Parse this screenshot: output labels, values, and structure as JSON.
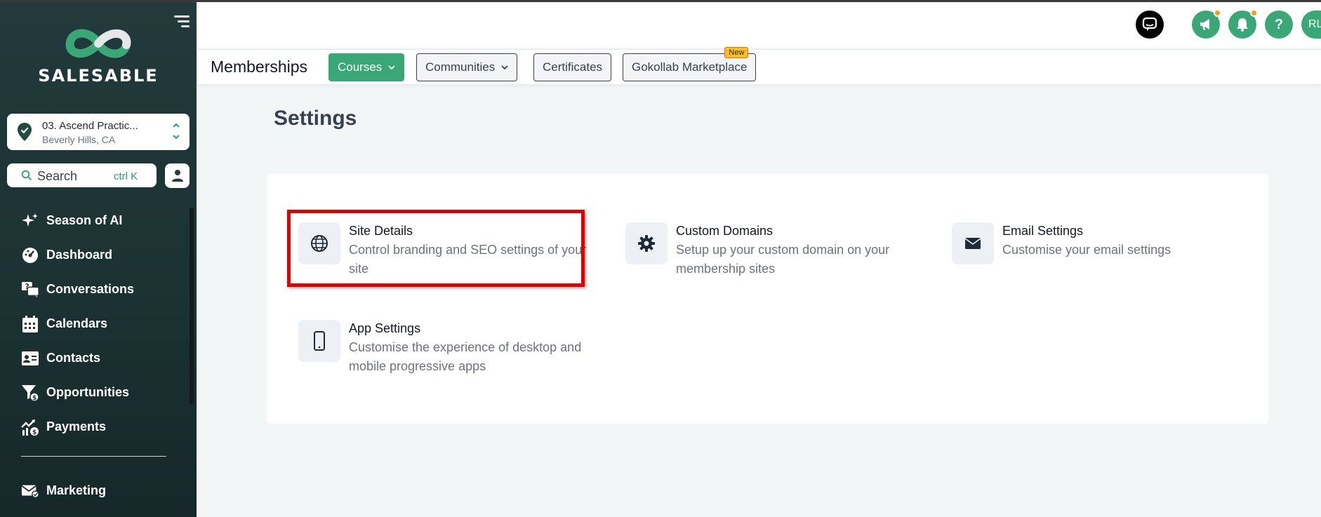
{
  "sidebar": {
    "brand": "SALESABLE",
    "location": {
      "name": "03. Ascend Practic...",
      "sub": "Beverly Hills, CA"
    },
    "search": {
      "label": "Search",
      "shortcut": "ctrl K"
    },
    "items": [
      {
        "label": "Season of AI",
        "icon": "sparkle-icon"
      },
      {
        "label": "Dashboard",
        "icon": "dashboard-icon"
      },
      {
        "label": "Conversations",
        "icon": "chat-icon"
      },
      {
        "label": "Calendars",
        "icon": "calendar-icon"
      },
      {
        "label": "Contacts",
        "icon": "contact-card-icon"
      },
      {
        "label": "Opportunities",
        "icon": "funnel-icon"
      },
      {
        "label": "Payments",
        "icon": "chart-money-icon"
      }
    ],
    "marketing": {
      "label": "Marketing",
      "icon": "mail-check-icon"
    }
  },
  "header": {
    "avatar_initials": "RL",
    "colors": {
      "accent": "#3aa876",
      "badge": "#f59e0b"
    }
  },
  "subnav": {
    "title": "Memberships",
    "tabs": [
      {
        "label": "Courses",
        "active": true,
        "dropdown": true
      },
      {
        "label": "Communities",
        "active": false,
        "dropdown": true
      },
      {
        "label": "Certificates",
        "active": false,
        "dropdown": false
      },
      {
        "label": "Gokollab Marketplace",
        "active": false,
        "dropdown": false,
        "badge": "New"
      }
    ]
  },
  "main": {
    "title": "Settings",
    "settings": [
      {
        "title": "Site Details",
        "desc": "Control branding and SEO settings of your site",
        "icon": "globe-icon"
      },
      {
        "title": "Custom Domains",
        "desc": "Setup up your custom domain on your membership sites",
        "icon": "gear-icon"
      },
      {
        "title": "Email Settings",
        "desc": "Customise your email settings",
        "icon": "envelope-icon"
      },
      {
        "title": "App Settings",
        "desc": "Customise the experience of desktop and mobile progressive apps",
        "icon": "mobile-phone-icon"
      }
    ]
  }
}
